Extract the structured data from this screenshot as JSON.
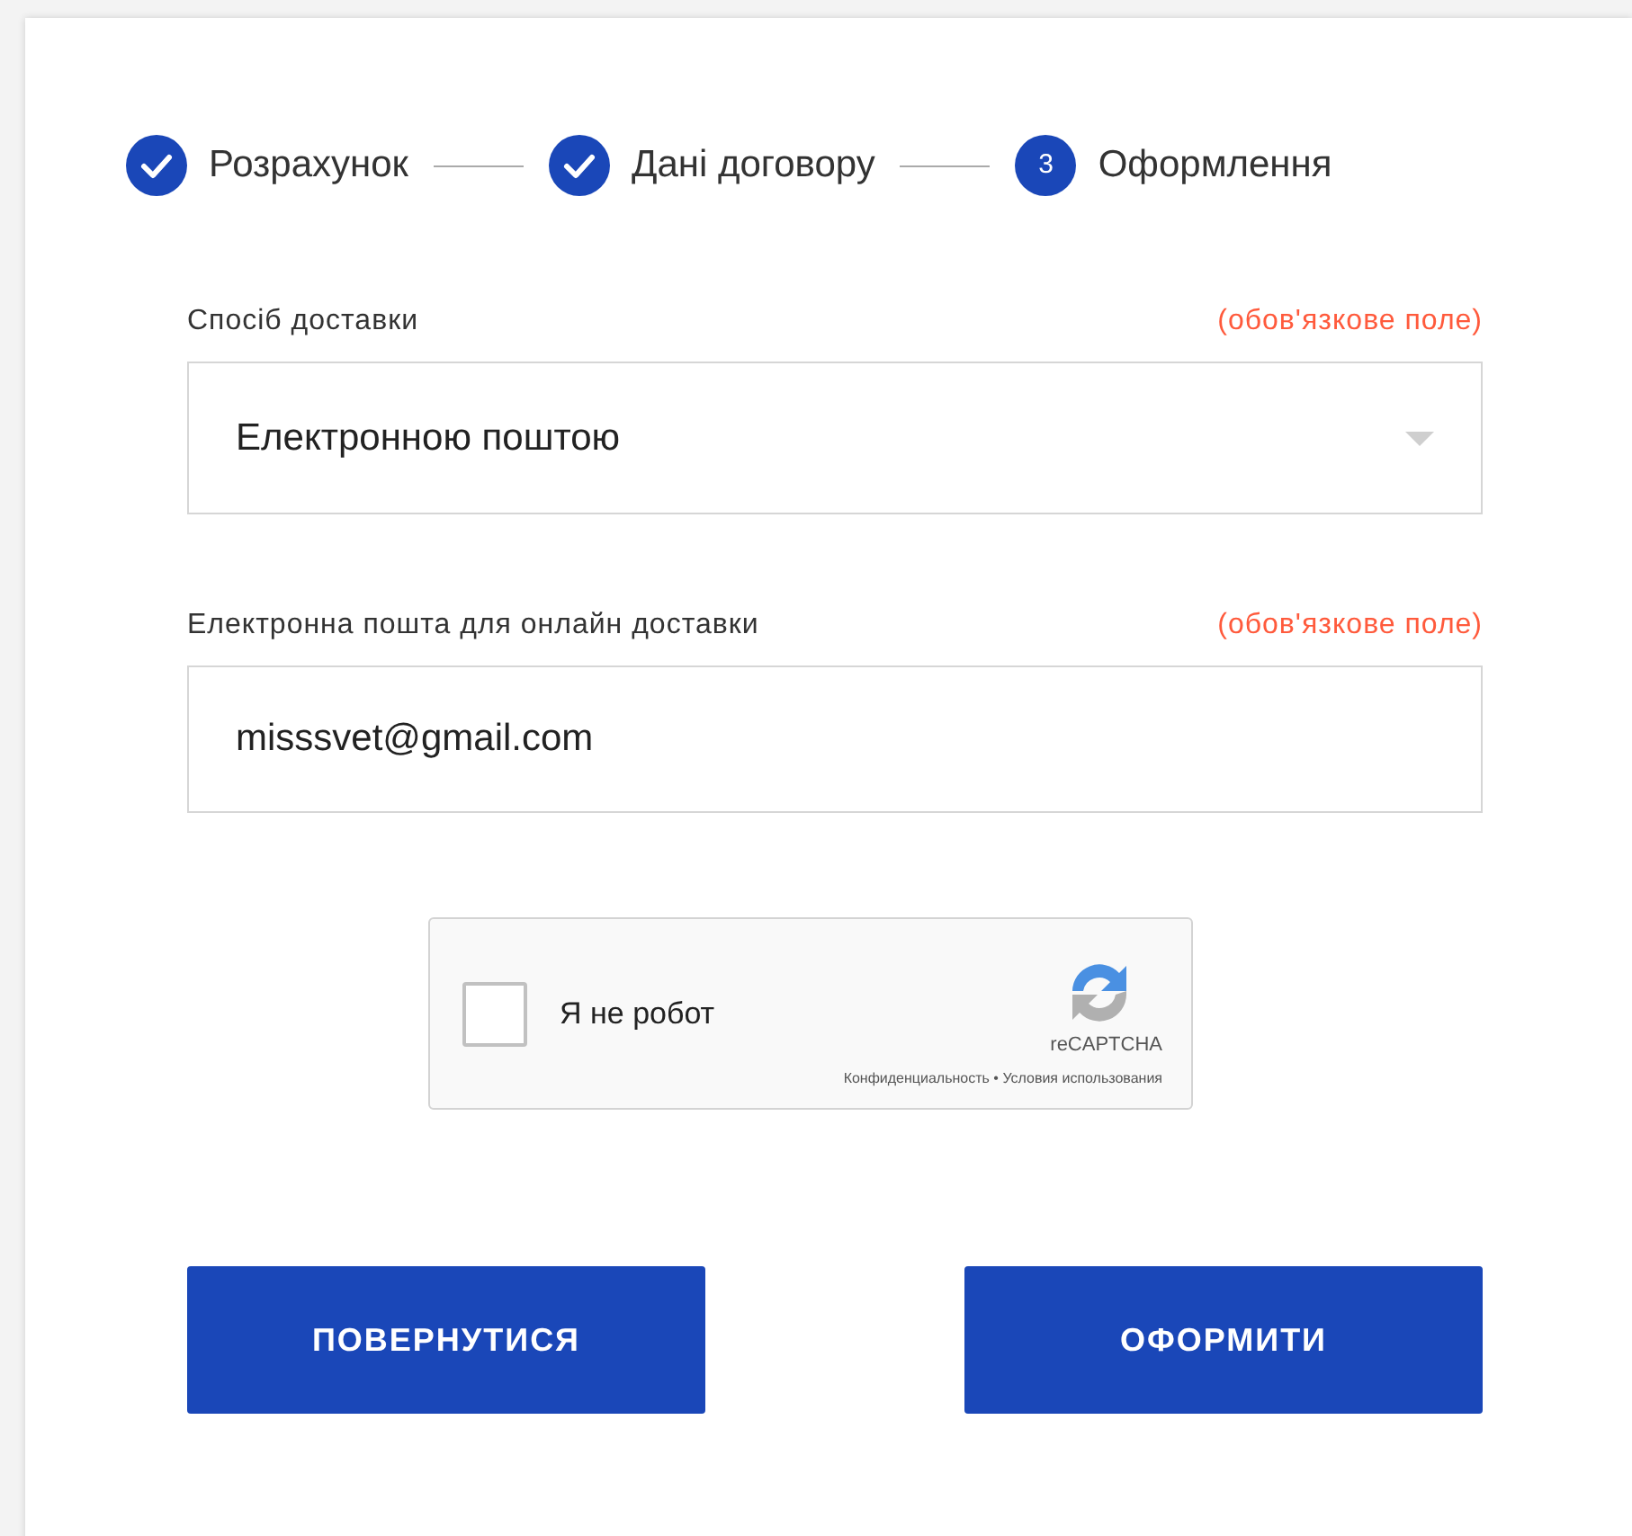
{
  "steps": [
    {
      "label": "Розрахунок",
      "completed": true
    },
    {
      "label": "Дані договору",
      "completed": true
    },
    {
      "label": "Оформлення",
      "completed": false,
      "number": "3"
    }
  ],
  "fields": [
    {
      "kind": "select",
      "label": "Спосіб доставки",
      "required_note": "(обов'язкове поле)",
      "value": "Електронною поштою"
    },
    {
      "kind": "input",
      "label": "Електронна пошта для онлайн доставки",
      "required_note": "(обов'язкове поле)",
      "value": "misssvet@gmail.com"
    }
  ],
  "captcha": {
    "checked": false,
    "label": "Я не робот",
    "brand": "reCAPTCHA",
    "footer": "Конфиденциальность • Условия использования"
  },
  "buttons": [
    "ПОВЕРНУТИСЯ",
    "ОФОРМИТИ"
  ]
}
